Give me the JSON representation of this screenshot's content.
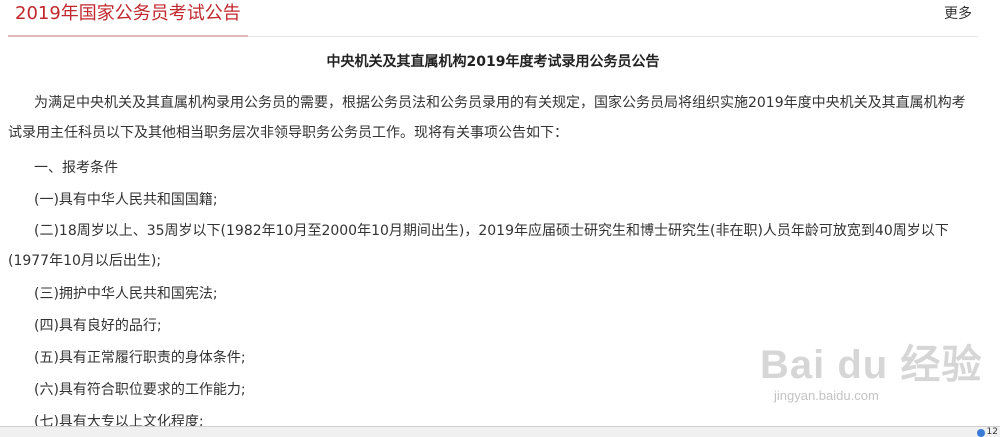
{
  "header": {
    "title": "2019年国家公务员考试公告",
    "more_label": "更多"
  },
  "article": {
    "title": "中央机关及其直属机构2019年度考试录用公务员公告",
    "paragraphs": [
      "为满足中央机关及其直属机构录用公务员的需要，根据公务员法和公务员录用的有关规定，国家公务员局将组织实施2019年度中央机关及其直属机构考试录用主任科员以下及其他相当职务层次非领导职务公务员工作。现将有关事项公告如下：",
      "一、报考条件",
      "(一)具有中华人民共和国国籍;",
      "(二)18周岁以上、35周岁以下(1982年10月至2000年10月期间出生)，2019年应届硕士研究生和博士研究生(非在职)人员年龄可放宽到40周岁以下(1977年10月以后出生);",
      "(三)拥护中华人民共和国宪法;",
      "(四)具有良好的品行;",
      "(五)具有正常履行职责的身体条件;",
      "(六)具有符合职位要求的工作能力;",
      "(七)具有大专以上文化程度;"
    ]
  },
  "watermark": {
    "brand": "Bai du 经验",
    "url": "jingyan.baidu.com"
  },
  "statusbar": {
    "zoom": "12"
  },
  "colors": {
    "header_title": "#c0282d",
    "text": "#333333"
  }
}
